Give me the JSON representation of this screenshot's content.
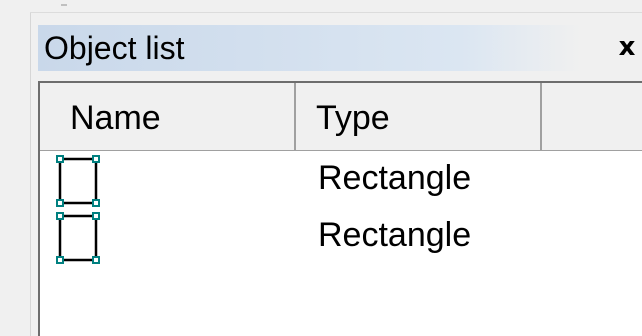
{
  "panel": {
    "title": "Object list",
    "close_label": "x"
  },
  "list": {
    "columns": [
      "Name",
      "Type",
      ""
    ],
    "rows": [
      {
        "name": "",
        "type": "Rectangle",
        "icon": "rectangle-icon"
      },
      {
        "name": "",
        "type": "Rectangle",
        "icon": "rectangle-icon"
      }
    ]
  },
  "colors": {
    "handle": "#008080",
    "titlebar": "#c9d8ea"
  }
}
